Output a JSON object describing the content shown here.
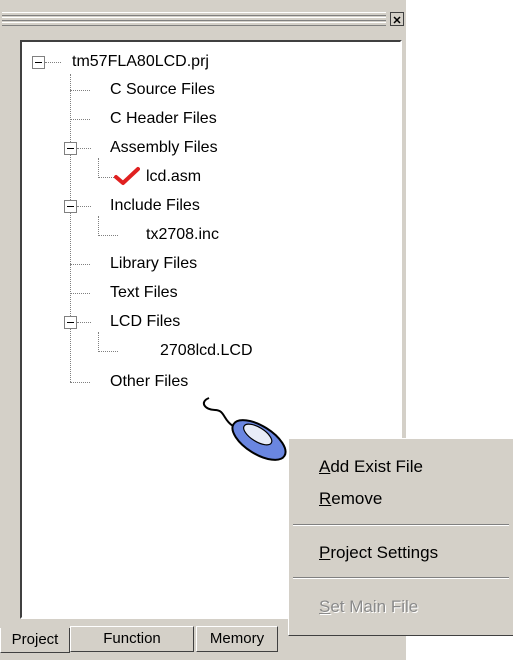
{
  "tree": {
    "project": "tm57FLA80LCD.prj",
    "folders": {
      "c_source": "C Source Files",
      "c_header": "C Header Files",
      "assembly": "Assembly Files",
      "include": "Include Files",
      "library": "Library Files",
      "text": "Text Files",
      "lcd": "LCD Files",
      "other": "Other Files"
    },
    "files": {
      "lcd_asm": "lcd.asm",
      "tx2708_inc": "tx2708.inc",
      "lcd_lcd": "2708lcd.LCD"
    }
  },
  "tabs": [
    "Project",
    "Function",
    "Memory"
  ],
  "context_menu": {
    "add_exist_file": {
      "accel": "A",
      "rest": "dd Exist File"
    },
    "remove": {
      "accel": "R",
      "rest": "emove"
    },
    "project_settings": {
      "accel": "P",
      "rest": "roject Settings"
    },
    "set_main_file": {
      "accel": "S",
      "rest": "et Main File",
      "disabled": true
    }
  },
  "colors": {
    "panel": "#d4d0c8",
    "check": "#e02020",
    "mouse_body": "#6a86e0"
  }
}
